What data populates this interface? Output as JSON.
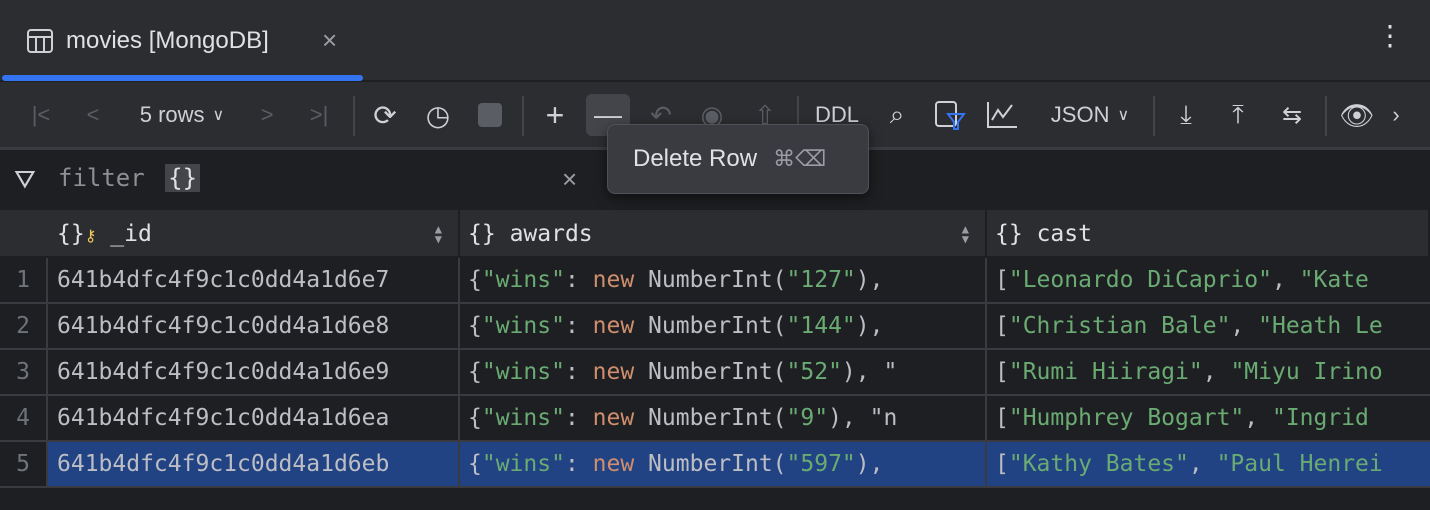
{
  "tab": {
    "title": "movies [MongoDB]"
  },
  "toolbar": {
    "rows_label": "5 rows",
    "ddl": "DDL",
    "format": "JSON"
  },
  "tooltip": {
    "label": "Delete Row",
    "shortcut": "⌘⌫"
  },
  "filter": {
    "label": "filter",
    "value": "{}"
  },
  "columns": [
    {
      "name": "_id"
    },
    {
      "name": "awards"
    },
    {
      "name": "cast"
    }
  ],
  "rows": [
    {
      "n": "1",
      "id": "641b4dfc4f9c1c0dd4a1d6e7",
      "wins": "\"127\"",
      "awards_tail": "),",
      "cast1": "\"Leonardo DiCaprio\"",
      "cast2": "\"Kate"
    },
    {
      "n": "2",
      "id": "641b4dfc4f9c1c0dd4a1d6e8",
      "wins": "\"144\"",
      "awards_tail": "),",
      "cast1": "\"Christian Bale\"",
      "cast2": "\"Heath Le"
    },
    {
      "n": "3",
      "id": "641b4dfc4f9c1c0dd4a1d6e9",
      "wins": "\"52\"",
      "awards_tail": "), \"",
      "cast1": "\"Rumi Hiiragi\"",
      "cast2": "\"Miyu Irino"
    },
    {
      "n": "4",
      "id": "641b4dfc4f9c1c0dd4a1d6ea",
      "wins": "\"9\"",
      "awards_tail": "), \"n",
      "cast1": "\"Humphrey Bogart\"",
      "cast2": "\"Ingrid"
    },
    {
      "n": "5",
      "id": "641b4dfc4f9c1c0dd4a1d6eb",
      "wins": "\"597\"",
      "awards_tail": "),",
      "cast1": "\"Kathy Bates\"",
      "cast2": "\"Paul Henrei"
    }
  ],
  "code": {
    "open": "{",
    "key": "\"wins\"",
    "colon": ": ",
    "kw": "new",
    "fn": " NumberInt(",
    "arr_open": "[",
    "comma": ", "
  }
}
